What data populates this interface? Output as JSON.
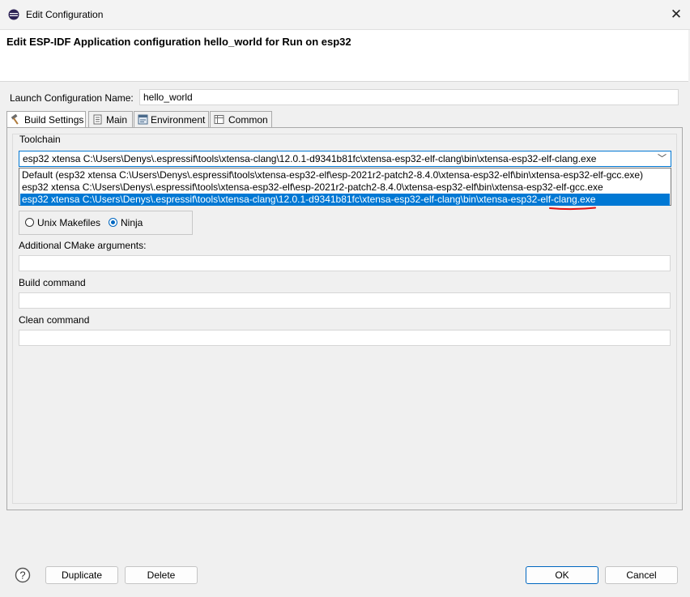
{
  "window": {
    "title": "Edit Configuration",
    "header_title": "Edit ESP-IDF Application configuration hello_world for Run on esp32"
  },
  "launch_config": {
    "label": "Launch Configuration Name:",
    "value": "hello_world"
  },
  "tabs": [
    {
      "label": "Build Settings",
      "icon": "hammer-icon",
      "active": true
    },
    {
      "label": "Main",
      "icon": "document-icon"
    },
    {
      "label": "Environment",
      "icon": "environment-icon"
    },
    {
      "label": "Common",
      "icon": "table-icon"
    }
  ],
  "toolchain": {
    "label": "Toolchain",
    "selected": "esp32 xtensa C:\\Users\\Denys\\.espressif\\tools\\xtensa-clang\\12.0.1-d9341b81fc\\xtensa-esp32-elf-clang\\bin\\xtensa-esp32-elf-clang.exe",
    "options": [
      "Default (esp32 xtensa C:\\Users\\Denys\\.espressif\\tools\\xtensa-esp32-elf\\esp-2021r2-patch2-8.4.0\\xtensa-esp32-elf\\bin\\xtensa-esp32-elf-gcc.exe)",
      "esp32 xtensa C:\\Users\\Denys\\.espressif\\tools\\xtensa-esp32-elf\\esp-2021r2-patch2-8.4.0\\xtensa-esp32-elf\\bin\\xtensa-esp32-elf-gcc.exe",
      "esp32 xtensa C:\\Users\\Denys\\.espressif\\tools\\xtensa-clang\\12.0.1-d9341b81fc\\xtensa-esp32-elf-clang\\bin\\xtensa-esp32-elf-clang.exe"
    ]
  },
  "generator": {
    "options": [
      "Unix Makefiles",
      "Ninja"
    ],
    "selected": "Ninja"
  },
  "cmake_args": {
    "label": "Additional CMake arguments:",
    "value": ""
  },
  "build_command": {
    "label": "Build command",
    "value": ""
  },
  "clean_command": {
    "label": "Clean command",
    "value": ""
  },
  "buttons": {
    "duplicate": "Duplicate",
    "delete": "Delete",
    "ok": "OK",
    "cancel": "Cancel"
  },
  "colors": {
    "selection": "#0078d4",
    "annotation": "#e01010"
  }
}
